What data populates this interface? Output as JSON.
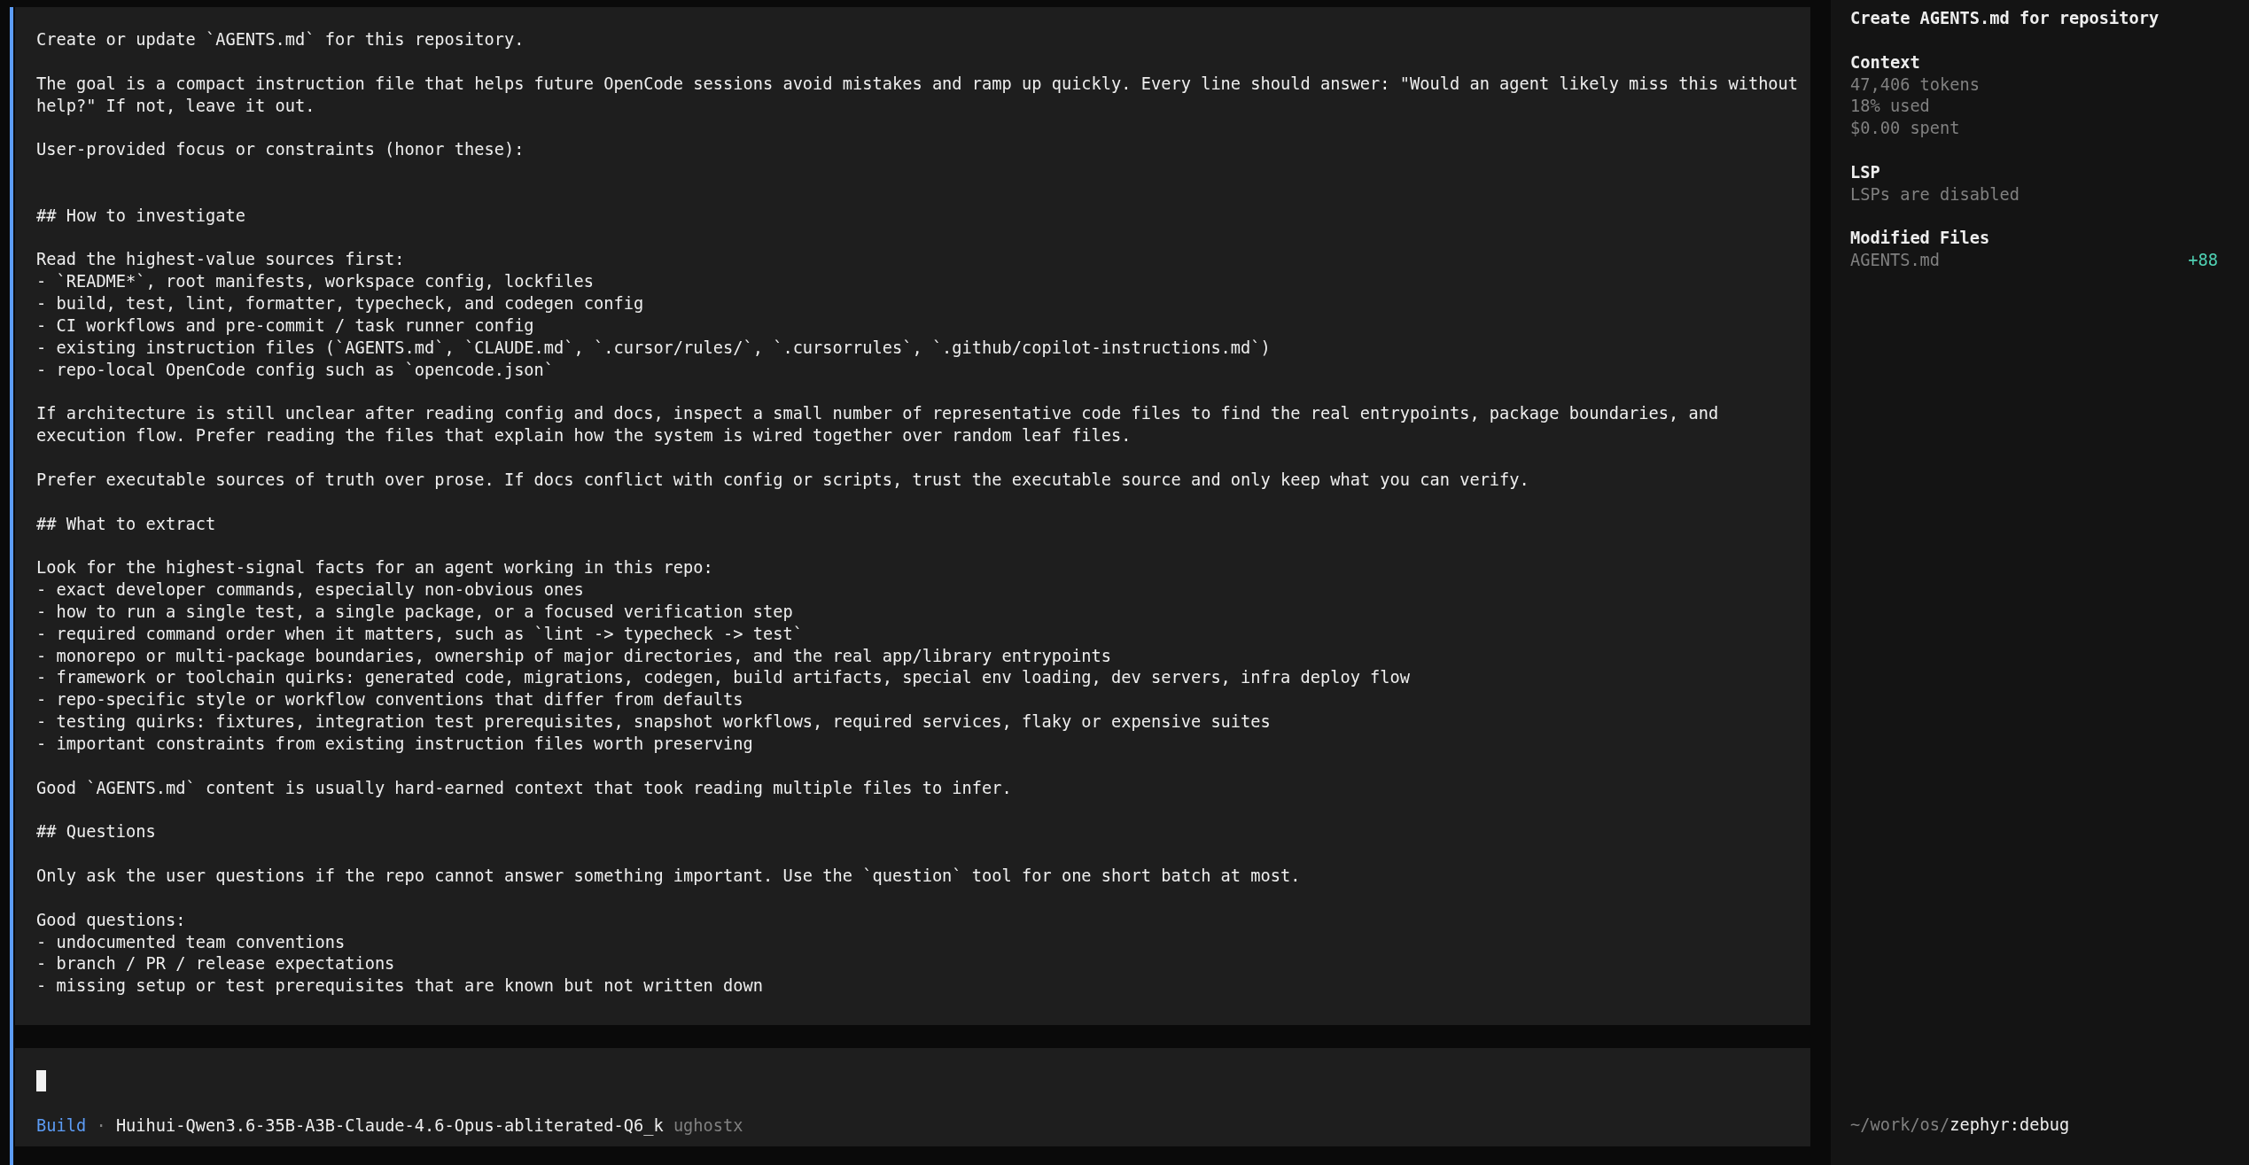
{
  "message": {
    "blocks": [
      {
        "kind": "paragraph",
        "text": "Create or update `AGENTS.md` for this repository."
      },
      {
        "kind": "paragraph",
        "text": "The goal is a compact instruction file that helps future OpenCode sessions avoid mistakes and ramp up quickly. Every line should answer: \"Would an agent likely miss this without help?\" If not, leave it out."
      },
      {
        "kind": "label",
        "text": "User-provided focus or constraints (honor these):"
      },
      {
        "kind": "heading",
        "text": "## How to investigate"
      },
      {
        "kind": "list",
        "lead": "Read the highest-value sources first:",
        "items": [
          "- `README*`, root manifests, workspace config, lockfiles",
          "- build, test, lint, formatter, typecheck, and codegen config",
          "- CI workflows and pre-commit / task runner config",
          "- existing instruction files (`AGENTS.md`, `CLAUDE.md`, `.cursor/rules/`, `.cursorrules`, `.github/copilot-instructions.md`)",
          "- repo-local OpenCode config such as `opencode.json`"
        ]
      },
      {
        "kind": "paragraph",
        "text": "If architecture is still unclear after reading config and docs, inspect a small number of representative code files to find the real entrypoints, package boundaries, and execution flow. Prefer reading the files that explain how the system is wired together over random leaf files."
      },
      {
        "kind": "paragraph",
        "text": "Prefer executable sources of truth over prose. If docs conflict with config or scripts, trust the executable source and only keep what you can verify."
      },
      {
        "kind": "heading",
        "text": "## What to extract"
      },
      {
        "kind": "list",
        "lead": "Look for the highest-signal facts for an agent working in this repo:",
        "items": [
          "- exact developer commands, especially non-obvious ones",
          "- how to run a single test, a single package, or a focused verification step",
          "- required command order when it matters, such as `lint -> typecheck -> test`",
          "- monorepo or multi-package boundaries, ownership of major directories, and the real app/library entrypoints",
          "- framework or toolchain quirks: generated code, migrations, codegen, build artifacts, special env loading, dev servers, infra deploy flow",
          "- repo-specific style or workflow conventions that differ from defaults",
          "- testing quirks: fixtures, integration test prerequisites, snapshot workflows, required services, flaky or expensive suites",
          "- important constraints from existing instruction files worth preserving"
        ]
      },
      {
        "kind": "paragraph",
        "text": "Good `AGENTS.md` content is usually hard-earned context that took reading multiple files to infer."
      },
      {
        "kind": "heading",
        "text": "## Questions"
      },
      {
        "kind": "paragraph",
        "text": "Only ask the user questions if the repo cannot answer something important. Use the `question` tool for one short batch at most."
      },
      {
        "kind": "list",
        "lead": "Good questions:",
        "items": [
          "- undocumented team conventions",
          "- branch / PR / release expectations",
          "- missing setup or test prerequisites that are known but not written down"
        ]
      }
    ]
  },
  "prompt": {
    "agent": "Build",
    "separator": "·",
    "model": "Huihui-Qwen3.6-35B-A3B-Claude-4.6-Opus-abliterated-Q6_k",
    "provider": "ughostx"
  },
  "sidebar": {
    "title": "Create AGENTS.md for repository",
    "sections": [
      {
        "heading": "Context",
        "lines": [
          "47,406 tokens",
          "18% used",
          "$0.00 spent"
        ]
      },
      {
        "heading": "LSP",
        "lines": [
          "LSPs are disabled"
        ]
      },
      {
        "heading": "Modified Files",
        "files": [
          {
            "name": "AGENTS.md",
            "additions": "+88"
          }
        ]
      }
    ],
    "directory": {
      "parent": "~/work/os/",
      "name": "zephyr:debug"
    }
  }
}
